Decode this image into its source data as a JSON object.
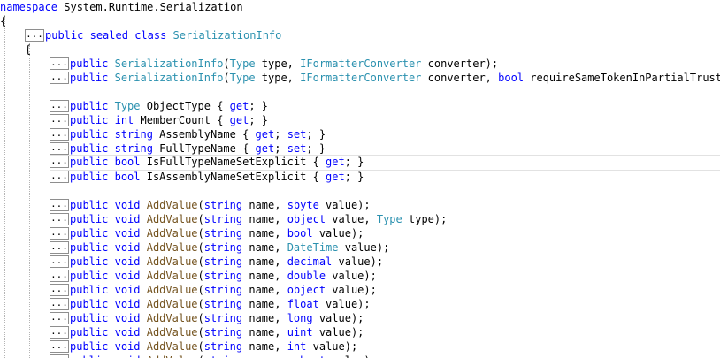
{
  "editor": {
    "lines": [
      {
        "indent": 0,
        "fold": false,
        "tokens": [
          {
            "t": "namespace",
            "c": "kw"
          },
          {
            "t": " System.Runtime.Serialization",
            "c": "pl"
          }
        ]
      },
      {
        "indent": 0,
        "fold": false,
        "tokens": [
          {
            "t": "{",
            "c": "pl"
          }
        ]
      },
      {
        "indent": 28,
        "fold": true,
        "tokens": [
          {
            "t": "public",
            "c": "kw"
          },
          {
            "t": " ",
            "c": "pl"
          },
          {
            "t": "sealed",
            "c": "kw"
          },
          {
            "t": " ",
            "c": "pl"
          },
          {
            "t": "class",
            "c": "kw"
          },
          {
            "t": " ",
            "c": "pl"
          },
          {
            "t": "SerializationInfo",
            "c": "ty"
          }
        ]
      },
      {
        "indent": 28,
        "fold": false,
        "tokens": [
          {
            "t": "{",
            "c": "pl"
          }
        ]
      },
      {
        "indent": 56,
        "fold": true,
        "tokens": [
          {
            "t": "public",
            "c": "kw"
          },
          {
            "t": " ",
            "c": "pl"
          },
          {
            "t": "SerializationInfo",
            "c": "ty"
          },
          {
            "t": "(",
            "c": "pl"
          },
          {
            "t": "Type",
            "c": "ty"
          },
          {
            "t": " type, ",
            "c": "pl"
          },
          {
            "t": "IFormatterConverter",
            "c": "ty"
          },
          {
            "t": " converter);",
            "c": "pl"
          }
        ]
      },
      {
        "indent": 56,
        "fold": true,
        "tokens": [
          {
            "t": "public",
            "c": "kw"
          },
          {
            "t": " ",
            "c": "pl"
          },
          {
            "t": "SerializationInfo",
            "c": "ty"
          },
          {
            "t": "(",
            "c": "pl"
          },
          {
            "t": "Type",
            "c": "ty"
          },
          {
            "t": " type, ",
            "c": "pl"
          },
          {
            "t": "IFormatterConverter",
            "c": "ty"
          },
          {
            "t": " converter, ",
            "c": "pl"
          },
          {
            "t": "bool",
            "c": "kw"
          },
          {
            "t": " requireSameTokenInPartialTrust);",
            "c": "pl"
          }
        ]
      },
      {
        "indent": 56,
        "fold": false,
        "tokens": []
      },
      {
        "indent": 56,
        "fold": true,
        "tokens": [
          {
            "t": "public",
            "c": "kw"
          },
          {
            "t": " ",
            "c": "pl"
          },
          {
            "t": "Type",
            "c": "ty"
          },
          {
            "t": " ObjectType { ",
            "c": "pl"
          },
          {
            "t": "get",
            "c": "kw"
          },
          {
            "t": "; }",
            "c": "pl"
          }
        ]
      },
      {
        "indent": 56,
        "fold": true,
        "tokens": [
          {
            "t": "public",
            "c": "kw"
          },
          {
            "t": " ",
            "c": "pl"
          },
          {
            "t": "int",
            "c": "kw"
          },
          {
            "t": " MemberCount { ",
            "c": "pl"
          },
          {
            "t": "get",
            "c": "kw"
          },
          {
            "t": "; }",
            "c": "pl"
          }
        ]
      },
      {
        "indent": 56,
        "fold": true,
        "tokens": [
          {
            "t": "public",
            "c": "kw"
          },
          {
            "t": " ",
            "c": "pl"
          },
          {
            "t": "string",
            "c": "kw"
          },
          {
            "t": " AssemblyName { ",
            "c": "pl"
          },
          {
            "t": "get",
            "c": "kw"
          },
          {
            "t": "; ",
            "c": "pl"
          },
          {
            "t": "set",
            "c": "kw"
          },
          {
            "t": "; }",
            "c": "pl"
          }
        ]
      },
      {
        "indent": 56,
        "fold": true,
        "tokens": [
          {
            "t": "public",
            "c": "kw"
          },
          {
            "t": " ",
            "c": "pl"
          },
          {
            "t": "string",
            "c": "kw"
          },
          {
            "t": " FullTypeName { ",
            "c": "pl"
          },
          {
            "t": "get",
            "c": "kw"
          },
          {
            "t": "; ",
            "c": "pl"
          },
          {
            "t": "set",
            "c": "kw"
          },
          {
            "t": "; }",
            "c": "pl"
          }
        ]
      },
      {
        "indent": 56,
        "fold": true,
        "current": true,
        "tokens": [
          {
            "t": "public",
            "c": "kw"
          },
          {
            "t": " ",
            "c": "pl"
          },
          {
            "t": "bool",
            "c": "kw"
          },
          {
            "t": " IsFullTypeNameSetExplicit { ",
            "c": "pl"
          },
          {
            "t": "get",
            "c": "kw"
          },
          {
            "t": "; }",
            "c": "pl"
          }
        ]
      },
      {
        "indent": 56,
        "fold": true,
        "tokens": [
          {
            "t": "public",
            "c": "kw"
          },
          {
            "t": " ",
            "c": "pl"
          },
          {
            "t": "bool",
            "c": "kw"
          },
          {
            "t": " IsAssemblyNameSetExplicit { ",
            "c": "pl"
          },
          {
            "t": "get",
            "c": "kw"
          },
          {
            "t": "; }",
            "c": "pl"
          }
        ]
      },
      {
        "indent": 56,
        "fold": false,
        "tokens": []
      },
      {
        "indent": 56,
        "fold": true,
        "tokens": [
          {
            "t": "public",
            "c": "kw"
          },
          {
            "t": " ",
            "c": "pl"
          },
          {
            "t": "void",
            "c": "kw"
          },
          {
            "t": " ",
            "c": "pl"
          },
          {
            "t": "AddValue",
            "c": "me"
          },
          {
            "t": "(",
            "c": "pl"
          },
          {
            "t": "string",
            "c": "kw"
          },
          {
            "t": " name, ",
            "c": "pl"
          },
          {
            "t": "sbyte",
            "c": "kw"
          },
          {
            "t": " value);",
            "c": "pl"
          }
        ]
      },
      {
        "indent": 56,
        "fold": true,
        "tokens": [
          {
            "t": "public",
            "c": "kw"
          },
          {
            "t": " ",
            "c": "pl"
          },
          {
            "t": "void",
            "c": "kw"
          },
          {
            "t": " ",
            "c": "pl"
          },
          {
            "t": "AddValue",
            "c": "me"
          },
          {
            "t": "(",
            "c": "pl"
          },
          {
            "t": "string",
            "c": "kw"
          },
          {
            "t": " name, ",
            "c": "pl"
          },
          {
            "t": "object",
            "c": "kw"
          },
          {
            "t": " value, ",
            "c": "pl"
          },
          {
            "t": "Type",
            "c": "ty"
          },
          {
            "t": " type);",
            "c": "pl"
          }
        ]
      },
      {
        "indent": 56,
        "fold": true,
        "tokens": [
          {
            "t": "public",
            "c": "kw"
          },
          {
            "t": " ",
            "c": "pl"
          },
          {
            "t": "void",
            "c": "kw"
          },
          {
            "t": " ",
            "c": "pl"
          },
          {
            "t": "AddValue",
            "c": "me"
          },
          {
            "t": "(",
            "c": "pl"
          },
          {
            "t": "string",
            "c": "kw"
          },
          {
            "t": " name, ",
            "c": "pl"
          },
          {
            "t": "bool",
            "c": "kw"
          },
          {
            "t": " value);",
            "c": "pl"
          }
        ]
      },
      {
        "indent": 56,
        "fold": true,
        "tokens": [
          {
            "t": "public",
            "c": "kw"
          },
          {
            "t": " ",
            "c": "pl"
          },
          {
            "t": "void",
            "c": "kw"
          },
          {
            "t": " ",
            "c": "pl"
          },
          {
            "t": "AddValue",
            "c": "me"
          },
          {
            "t": "(",
            "c": "pl"
          },
          {
            "t": "string",
            "c": "kw"
          },
          {
            "t": " name, ",
            "c": "pl"
          },
          {
            "t": "DateTime",
            "c": "ty"
          },
          {
            "t": " value);",
            "c": "pl"
          }
        ]
      },
      {
        "indent": 56,
        "fold": true,
        "tokens": [
          {
            "t": "public",
            "c": "kw"
          },
          {
            "t": " ",
            "c": "pl"
          },
          {
            "t": "void",
            "c": "kw"
          },
          {
            "t": " ",
            "c": "pl"
          },
          {
            "t": "AddValue",
            "c": "me"
          },
          {
            "t": "(",
            "c": "pl"
          },
          {
            "t": "string",
            "c": "kw"
          },
          {
            "t": " name, ",
            "c": "pl"
          },
          {
            "t": "decimal",
            "c": "kw"
          },
          {
            "t": " value);",
            "c": "pl"
          }
        ]
      },
      {
        "indent": 56,
        "fold": true,
        "tokens": [
          {
            "t": "public",
            "c": "kw"
          },
          {
            "t": " ",
            "c": "pl"
          },
          {
            "t": "void",
            "c": "kw"
          },
          {
            "t": " ",
            "c": "pl"
          },
          {
            "t": "AddValue",
            "c": "me"
          },
          {
            "t": "(",
            "c": "pl"
          },
          {
            "t": "string",
            "c": "kw"
          },
          {
            "t": " name, ",
            "c": "pl"
          },
          {
            "t": "double",
            "c": "kw"
          },
          {
            "t": " value);",
            "c": "pl"
          }
        ]
      },
      {
        "indent": 56,
        "fold": true,
        "tokens": [
          {
            "t": "public",
            "c": "kw"
          },
          {
            "t": " ",
            "c": "pl"
          },
          {
            "t": "void",
            "c": "kw"
          },
          {
            "t": " ",
            "c": "pl"
          },
          {
            "t": "AddValue",
            "c": "me"
          },
          {
            "t": "(",
            "c": "pl"
          },
          {
            "t": "string",
            "c": "kw"
          },
          {
            "t": " name, ",
            "c": "pl"
          },
          {
            "t": "object",
            "c": "kw"
          },
          {
            "t": " value);",
            "c": "pl"
          }
        ]
      },
      {
        "indent": 56,
        "fold": true,
        "tokens": [
          {
            "t": "public",
            "c": "kw"
          },
          {
            "t": " ",
            "c": "pl"
          },
          {
            "t": "void",
            "c": "kw"
          },
          {
            "t": " ",
            "c": "pl"
          },
          {
            "t": "AddValue",
            "c": "me"
          },
          {
            "t": "(",
            "c": "pl"
          },
          {
            "t": "string",
            "c": "kw"
          },
          {
            "t": " name, ",
            "c": "pl"
          },
          {
            "t": "float",
            "c": "kw"
          },
          {
            "t": " value);",
            "c": "pl"
          }
        ]
      },
      {
        "indent": 56,
        "fold": true,
        "tokens": [
          {
            "t": "public",
            "c": "kw"
          },
          {
            "t": " ",
            "c": "pl"
          },
          {
            "t": "void",
            "c": "kw"
          },
          {
            "t": " ",
            "c": "pl"
          },
          {
            "t": "AddValue",
            "c": "me"
          },
          {
            "t": "(",
            "c": "pl"
          },
          {
            "t": "string",
            "c": "kw"
          },
          {
            "t": " name, ",
            "c": "pl"
          },
          {
            "t": "long",
            "c": "kw"
          },
          {
            "t": " value);",
            "c": "pl"
          }
        ]
      },
      {
        "indent": 56,
        "fold": true,
        "tokens": [
          {
            "t": "public",
            "c": "kw"
          },
          {
            "t": " ",
            "c": "pl"
          },
          {
            "t": "void",
            "c": "kw"
          },
          {
            "t": " ",
            "c": "pl"
          },
          {
            "t": "AddValue",
            "c": "me"
          },
          {
            "t": "(",
            "c": "pl"
          },
          {
            "t": "string",
            "c": "kw"
          },
          {
            "t": " name, ",
            "c": "pl"
          },
          {
            "t": "uint",
            "c": "kw"
          },
          {
            "t": " value);",
            "c": "pl"
          }
        ]
      },
      {
        "indent": 56,
        "fold": true,
        "tokens": [
          {
            "t": "public",
            "c": "kw"
          },
          {
            "t": " ",
            "c": "pl"
          },
          {
            "t": "void",
            "c": "kw"
          },
          {
            "t": " ",
            "c": "pl"
          },
          {
            "t": "AddValue",
            "c": "me"
          },
          {
            "t": "(",
            "c": "pl"
          },
          {
            "t": "string",
            "c": "kw"
          },
          {
            "t": " name, ",
            "c": "pl"
          },
          {
            "t": "int",
            "c": "kw"
          },
          {
            "t": " value);",
            "c": "pl"
          }
        ]
      },
      {
        "indent": 56,
        "fold": true,
        "tokens": [
          {
            "t": "public",
            "c": "kw"
          },
          {
            "t": " ",
            "c": "pl"
          },
          {
            "t": "void",
            "c": "kw"
          },
          {
            "t": " ",
            "c": "pl"
          },
          {
            "t": "AddValue",
            "c": "me"
          },
          {
            "t": "(",
            "c": "pl"
          },
          {
            "t": "string",
            "c": "kw"
          },
          {
            "t": " name, ",
            "c": "pl"
          },
          {
            "t": "ushort",
            "c": "kw"
          },
          {
            "t": " value);",
            "c": "pl"
          }
        ]
      }
    ],
    "fold_label": "...",
    "colors": {
      "keyword": "#0000ff",
      "type": "#2b91af",
      "method": "#74531f",
      "plain": "#000000"
    }
  }
}
